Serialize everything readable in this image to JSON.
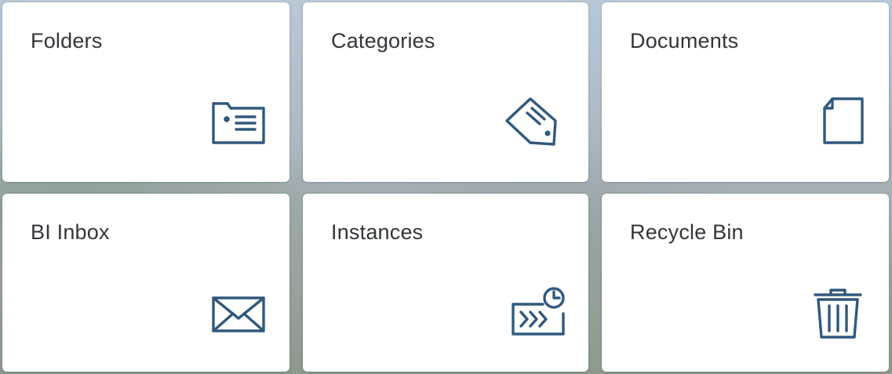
{
  "accent_color": "#31587d",
  "tiles": [
    {
      "label": "Folders",
      "icon": "folder-icon"
    },
    {
      "label": "Categories",
      "icon": "tag-icon"
    },
    {
      "label": "Documents",
      "icon": "document-icon"
    },
    {
      "label": "BI Inbox",
      "icon": "envelope-icon"
    },
    {
      "label": "Instances",
      "icon": "scheduled-instances-icon"
    },
    {
      "label": "Recycle Bin",
      "icon": "trash-icon"
    }
  ]
}
